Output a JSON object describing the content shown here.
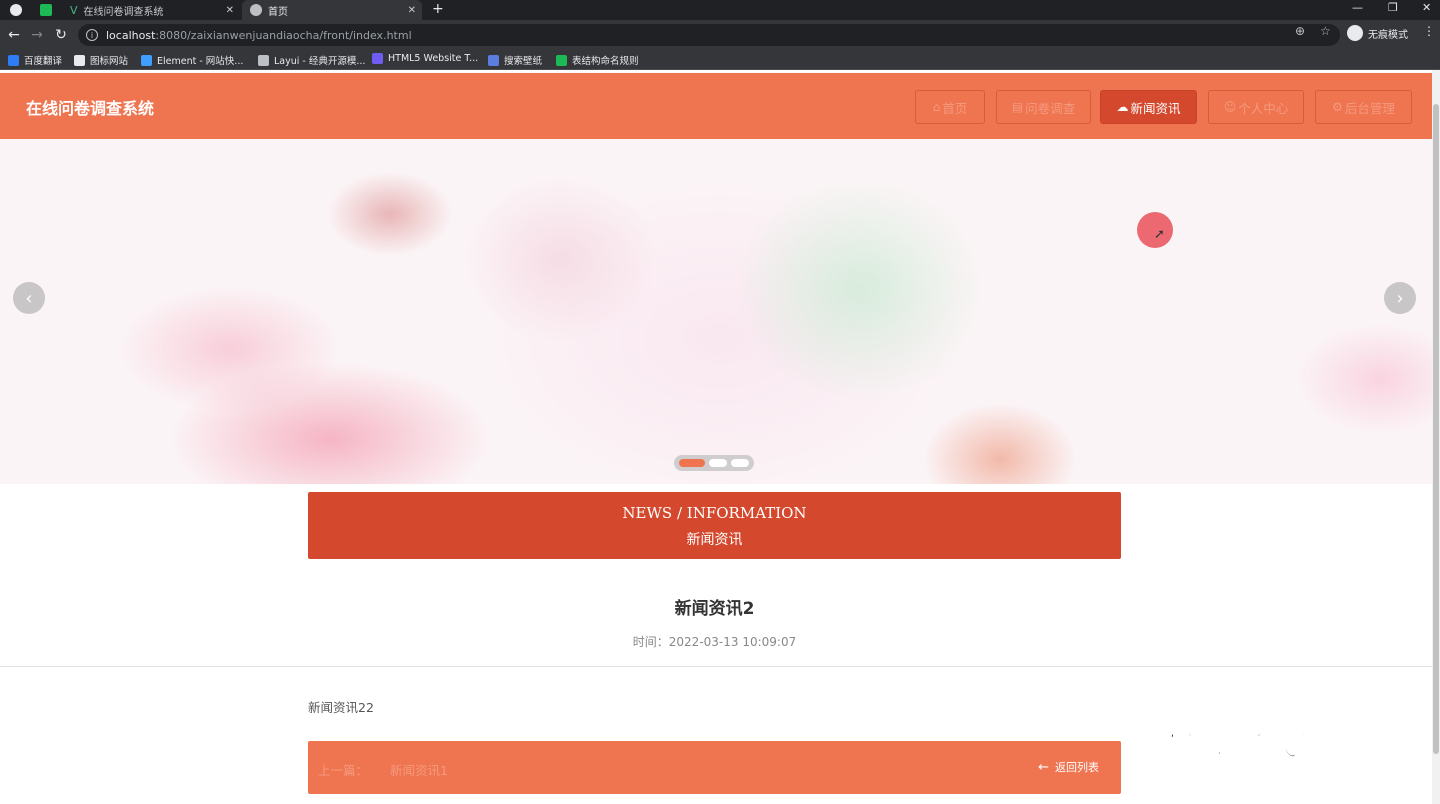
{
  "browser": {
    "tabs": [
      {
        "title": ""
      },
      {
        "title": "在线问卷调查系统"
      },
      {
        "title": "首页"
      }
    ],
    "new_tab": "+",
    "window_controls": [
      "—",
      "❐",
      "✕"
    ],
    "url_host": "localhost",
    "url_rest": ":8080/zaixianwenjuandiaocha/front/index.html",
    "incognito_label": "无痕模式",
    "bookmarks": [
      {
        "label": "百度翻译",
        "color": "#2e7cf6"
      },
      {
        "label": "图标网站",
        "color": "#e8eaed"
      },
      {
        "label": "Element - 网站快...",
        "color": "#409eff"
      },
      {
        "label": "Layui - 经典开源模...",
        "color": "#bdc1c6"
      },
      {
        "label": "HTML5 Website T...",
        "color": "#6f5cf0"
      },
      {
        "label": "搜索壁纸",
        "color": "#5b7de0"
      },
      {
        "label": "表结构命名规则",
        "color": "#1db954"
      }
    ]
  },
  "site": {
    "title": "在线问卷调查系统",
    "nav": [
      {
        "label": "首页",
        "icon": "home-icon",
        "active": false
      },
      {
        "label": "问卷调查",
        "icon": "survey-icon",
        "active": false
      },
      {
        "label": "新闻资讯",
        "icon": "cloud-icon",
        "active": true
      },
      {
        "label": "个人中心",
        "icon": "user-icon",
        "active": false
      },
      {
        "label": "后台管理",
        "icon": "settings-icon",
        "active": false
      }
    ],
    "accent_color": "#ef7450",
    "accent_dark": "#d4492e"
  },
  "carousel": {
    "slide_count": 3,
    "active_index": 0
  },
  "section": {
    "title_en": "NEWS / INFORMATION",
    "title_cn": "新闻资讯"
  },
  "article": {
    "title": "新闻资讯2",
    "time_label": "时间：",
    "time_value": "2022-03-13 10:09:07",
    "body": "新闻资讯22",
    "prev_label": "上一篇：",
    "prev_title": "新闻资讯1",
    "back_label": "返回列表"
  },
  "watermark": "毕设代做"
}
